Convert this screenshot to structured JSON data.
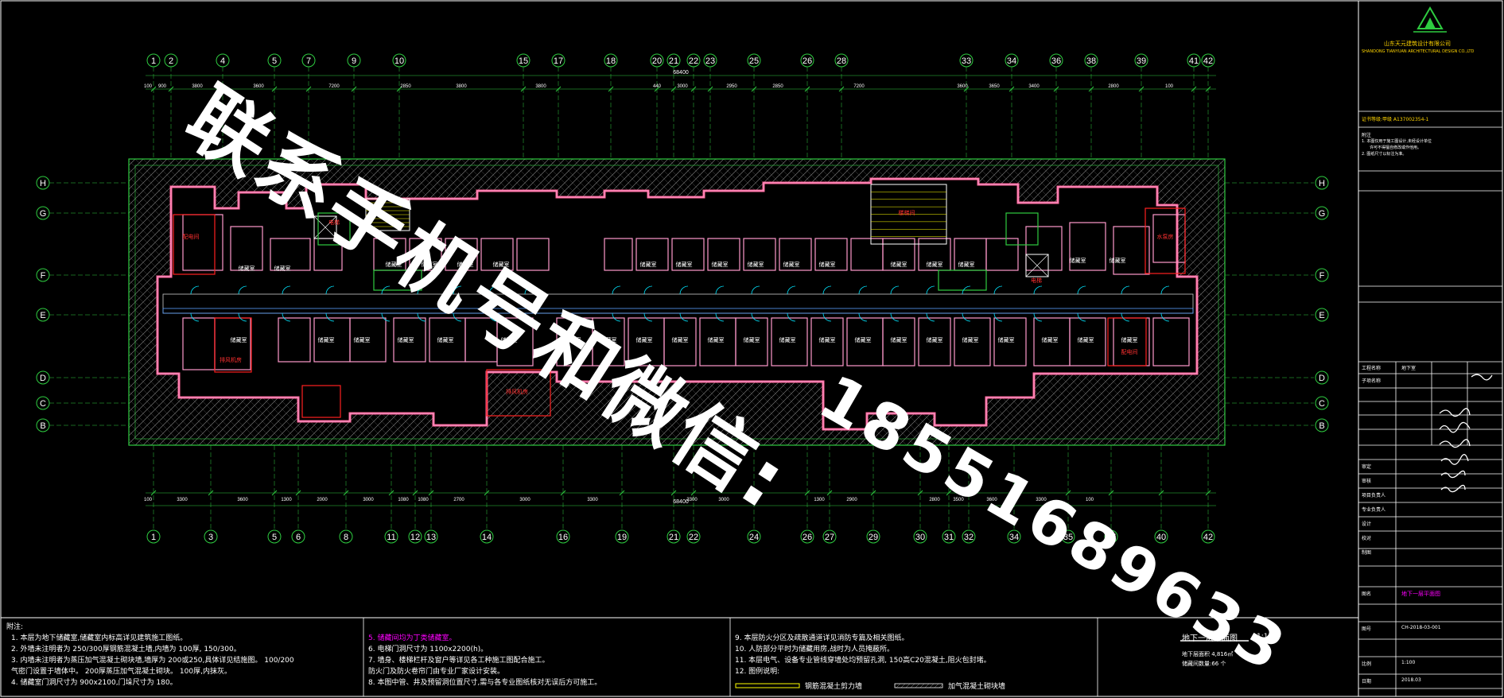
{
  "watermark": {
    "line1": "联系手机号和微信:",
    "line2": "18551689633"
  },
  "axes": {
    "top": [
      "1",
      "2",
      "4",
      "5",
      "7",
      "9",
      "10",
      "15",
      "17",
      "18",
      "20",
      "21",
      "22",
      "23",
      "25",
      "26",
      "28",
      "33",
      "34",
      "36",
      "38",
      "39",
      "41",
      "42"
    ],
    "bottom": [
      "1",
      "3",
      "5",
      "6",
      "8",
      "11",
      "12",
      "13",
      "14",
      "16",
      "19",
      "21",
      "22",
      "24",
      "26",
      "27",
      "29",
      "30",
      "31",
      "32",
      "34",
      "35",
      "37",
      "40",
      "42"
    ],
    "rows": [
      "H",
      "G",
      "F",
      "E",
      "D",
      "C",
      "B"
    ]
  },
  "dims": {
    "top_total": "68400",
    "bottom_total": "68400",
    "top_segments": [
      "100",
      "900",
      "3800",
      "",
      "3600",
      "",
      "7200",
      "",
      "2850",
      "3800",
      "3800",
      "",
      "440",
      "3000",
      "2950",
      "2850",
      "",
      "7200",
      "",
      "3600",
      "3650",
      "3400",
      "",
      "2800",
      "100"
    ],
    "bottom_segments": [
      "100",
      "3300",
      "3600",
      "1300",
      "2000",
      "3000",
      "1080",
      "1080",
      "2700",
      "3000",
      "3300",
      "",
      "3300",
      "3000",
      "1300",
      "2900",
      "",
      "2800",
      "3500",
      "3600",
      "3300",
      "100"
    ]
  },
  "rooms": {
    "storage": "储藏室",
    "elevator": "电梯",
    "shaft": "管井",
    "duct": "风井",
    "power": "配电间",
    "pump": "水泵房",
    "fan": "排风机房",
    "stair": "楼梯间"
  },
  "title_block": {
    "company": "山东天元建筑设计有限公司",
    "company_en": "SHANDONG TIANYUAN ARCHITECTURAL DESIGN CO.,LTD",
    "cert": "证书等级:甲级 A137002354-1",
    "notes_header": "附注",
    "note1": "1. 本图仅用于施工图设计,未经设计单位",
    "note2": "许可不得擅自修改或作他用。",
    "note3": "2. 图纸尺寸以标注为准。",
    "project_label": "工程名称",
    "project_name": "地下室",
    "subitem_label": "子项名称",
    "rows": [
      {
        "label": "审定",
        "name": ""
      },
      {
        "label": "审核",
        "name": ""
      },
      {
        "label": "项目负责人",
        "name": ""
      },
      {
        "label": "专业负责人",
        "name": ""
      },
      {
        "label": "设计",
        "name": ""
      },
      {
        "label": "校对",
        "name": ""
      },
      {
        "label": "制图",
        "name": ""
      }
    ],
    "drawing_label": "图名",
    "drawing_name": "地下一层平面图",
    "number_label": "图号",
    "number": "CH-2018-03-001",
    "scale_label": "比例",
    "scale": "1:100",
    "date_label": "日期",
    "date": "2018.03"
  },
  "bottom_notes": {
    "header": "附注:",
    "col1": [
      "1. 本层为地下储藏室,储藏室内标高详见建筑施工图纸。",
      "2. 外墙未注明者为 250/300厚钢筋混凝土墙,内墙为 100厚, 150/300。",
      "3. 内墙未注明者为蒸压加气混凝土砌块墙,墙厚为 200或250,具体详见结施图。 100/200",
      "气密门设置于墙体中。 200厚蒸压加气混凝土砌块。 100厚,内抹灰。",
      "4. 储藏室门洞尺寸为 900x2100,门垛尺寸为 180。"
    ],
    "col2": [
      "5. 储藏间均为丁类储藏室。",
      "6. 电梯门洞尺寸为 1100x2200(h)。",
      "7. 墙身、楼梯栏杆及窗户等详见各工种施工图配合施工。",
      "防火门及防火卷帘门由专业厂家设计安装。",
      "8. 本图中管、井及预留洞位置尺寸,需与各专业图纸核对无误后方可施工。"
    ],
    "col3": [
      "9. 本层防火分区及疏散通道详见消防专篇及相关图纸。",
      "10. 人防部分平时为储藏用房,战时为人员掩蔽所。",
      "11. 本层电气、设备专业管线穿墙处均预留孔洞, 150高C20混凝土,阻火包封堵。",
      "12. 图例说明:"
    ],
    "legend_a": "钢筋混凝土剪力墙",
    "legend_b": "加气混凝土砌块墙"
  },
  "drawing_title": {
    "name": "地下一层平面图",
    "scale": "1:100",
    "sub1": "地下层面积 4,816㎡",
    "sub2": "储藏间数量:66 个"
  }
}
